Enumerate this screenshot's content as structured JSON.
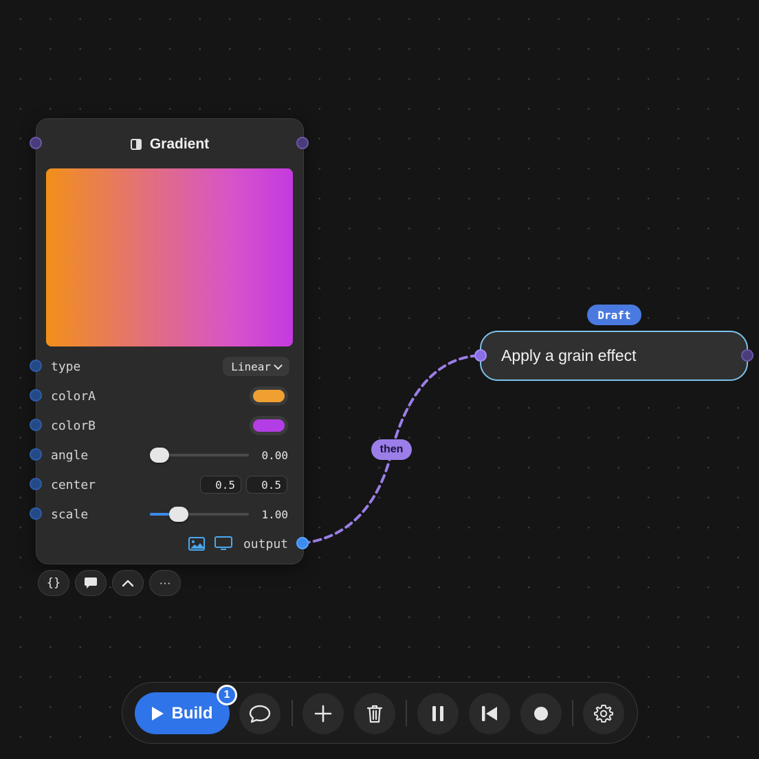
{
  "node": {
    "title": "Gradient",
    "icon": "gradient-icon",
    "params": {
      "type": {
        "label": "type",
        "value": "Linear"
      },
      "colorA": {
        "label": "colorA",
        "color": "#f0a030"
      },
      "colorB": {
        "label": "colorB",
        "color": "#b43ee6"
      },
      "angle": {
        "label": "angle",
        "value": "0.00",
        "fraction": 0.0
      },
      "center": {
        "label": "center",
        "x": "0.5",
        "y": "0.5"
      },
      "scale": {
        "label": "scale",
        "value": "1.00",
        "fraction": 0.29
      }
    },
    "output_label": "output",
    "output_icons": [
      "image-icon",
      "monitor-icon"
    ],
    "mini_toolbar": [
      "{}",
      "comment-icon",
      "chevron-up-icon",
      "···"
    ]
  },
  "prompt_node": {
    "badge": "Draft",
    "text": "Apply a grain effect"
  },
  "connection": {
    "label": "then"
  },
  "toolbar": {
    "build_label": "Build",
    "build_count": "1",
    "buttons": [
      "chat-icon",
      "add-icon",
      "trash-icon",
      "pause-icon",
      "skip-back-icon",
      "record-icon",
      "settings-icon"
    ]
  },
  "colors": {
    "background": "#151515",
    "accent": "#2f74e8",
    "wire": "#9b7ee8",
    "prompt_border": "#7cc3ea"
  }
}
